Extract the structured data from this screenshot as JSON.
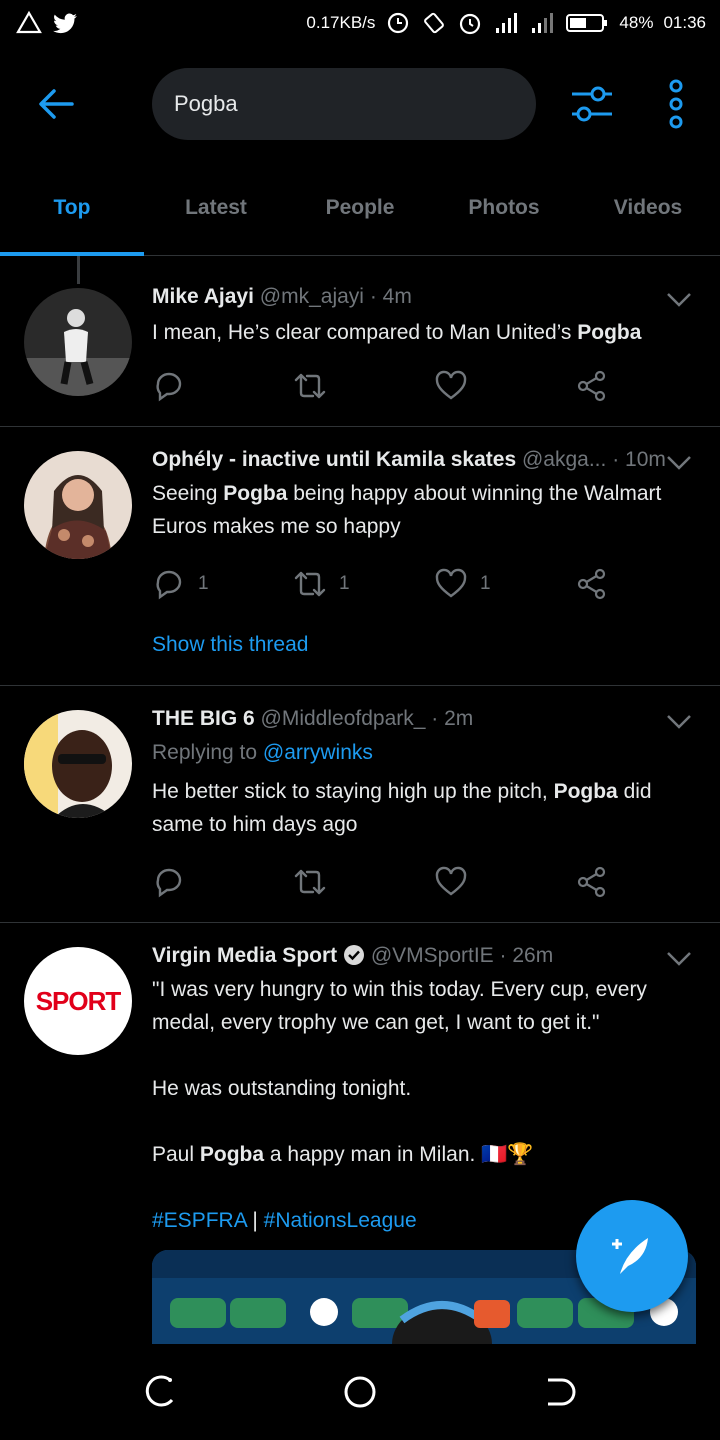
{
  "status_bar": {
    "net_speed": "0.17KB/s",
    "battery": "48%",
    "time": "01:36"
  },
  "search": {
    "query": "Pogba"
  },
  "tabs": [
    {
      "label": "Top",
      "active": true
    },
    {
      "label": "Latest",
      "active": false
    },
    {
      "label": "People",
      "active": false
    },
    {
      "label": "Photos",
      "active": false
    },
    {
      "label": "Videos",
      "active": false
    }
  ],
  "tweets": [
    {
      "name": "Mike Ajayi",
      "handle": "@mk_ajayi",
      "sep": "·",
      "time": "4m",
      "text_before": "I mean, He’s clear compared to Man United’s ",
      "text_bold": "Pogba",
      "text_after": ""
    },
    {
      "name": "Ophély - inactive until Kamila skates",
      "handle": "@akga...",
      "sep": "·",
      "time": "10m",
      "text_before": "Seeing ",
      "text_bold": "Pogba",
      "text_after": " being happy about winning the Walmart Euros makes me so happy",
      "replies": "1",
      "retweets": "1",
      "likes": "1",
      "show_thread": "Show this thread"
    },
    {
      "name": "THE BIG 6",
      "handle": "@Middleofdpark_",
      "sep": "·",
      "time": "2m",
      "replying_prefix": "Replying to ",
      "replying_to": "@arrywinks",
      "text_before": "He better stick to staying high up the pitch, ",
      "text_bold": "Pogba",
      "text_after": " did same to him days ago"
    },
    {
      "name": "Virgin Media Sport",
      "handle": "@VMSportIE",
      "sep": "·",
      "time": "26m",
      "quote": "\"I was very hungry to win this today. Every cup, every medal, every trophy we can get, I want to get it.\"",
      "line2": "He was outstanding tonight.",
      "line3_before": "Paul ",
      "line3_bold": "Pogba",
      "line3_after": " a happy man in Milan. 🇫🇷🏆",
      "hashtag1": "#ESPFRA",
      "hashtag_sep": " | ",
      "hashtag2": "#NationsLeague",
      "avatar_logo": "SPORT"
    }
  ],
  "colors": {
    "accent": "#1d9bf0",
    "background": "#000000",
    "secondary_text": "#71767b",
    "divider": "#2f3336"
  }
}
